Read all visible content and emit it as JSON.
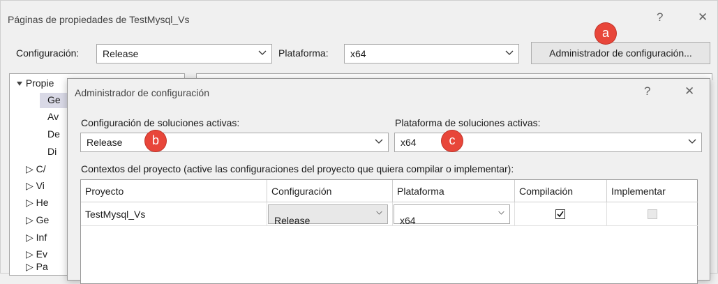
{
  "outer": {
    "title": "Páginas de propiedades de TestMysql_Vs",
    "help_glyph": "?",
    "close_glyph": "✕",
    "config_label": "Configuración:",
    "config_value": "Release",
    "platform_label": "Plataforma:",
    "platform_value": "x64",
    "config_manager_button": "Administrador de configuración..."
  },
  "tree": {
    "root_label": "Propie",
    "items": [
      "Ge",
      "Av",
      "De",
      "Di"
    ],
    "groups": [
      "C/",
      "Vi",
      "He",
      "Ge",
      "Inf",
      "Ev",
      "Pa"
    ]
  },
  "badges": {
    "a": "a",
    "b": "b",
    "c": "c"
  },
  "badge_color": "#e8463a",
  "dialog": {
    "title": "Administrador de configuración",
    "help_glyph": "?",
    "close_glyph": "✕",
    "active_config_label": "Configuración de soluciones activas:",
    "active_config_value": "Release",
    "active_platform_label": "Plataforma de soluciones activas:",
    "active_platform_value": "x64",
    "contexts_label": "Contextos del proyecto (active las configuraciones del proyecto que quiera compilar o implementar):",
    "columns": [
      "Proyecto",
      "Configuración",
      "Plataforma",
      "Compilación",
      "Implementar"
    ],
    "rows": [
      {
        "project": "TestMysql_Vs",
        "configuration": "Release",
        "platform": "x64",
        "build": true,
        "deploy": false
      }
    ]
  }
}
